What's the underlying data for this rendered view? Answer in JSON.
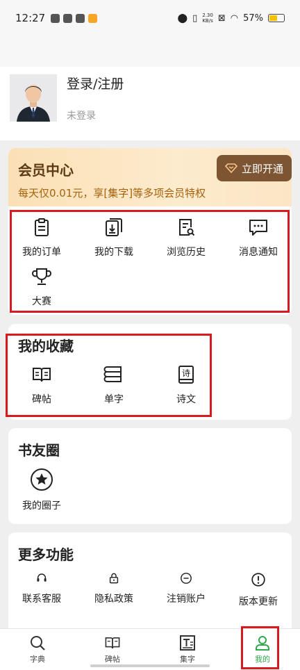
{
  "status_bar": {
    "time": "12:27",
    "net_speed_value": "2.30",
    "net_speed_unit": "KB/s",
    "battery": "57%",
    "battery_level": 0.57
  },
  "profile": {
    "title": "登录/注册",
    "subtitle": "未登录"
  },
  "member": {
    "title": "会员中心",
    "desc": "每天仅0.01元，享[集字]等多项会员特权",
    "button": "立即开通"
  },
  "quick_links": [
    {
      "label": "我的订单",
      "icon": "clipboard-icon"
    },
    {
      "label": "我的下载",
      "icon": "download-icon"
    },
    {
      "label": "浏览历史",
      "icon": "history-search-icon"
    },
    {
      "label": "消息通知",
      "icon": "message-icon"
    },
    {
      "label": "大赛",
      "icon": "trophy-icon"
    }
  ],
  "favorites": {
    "title": "我的收藏",
    "items": [
      {
        "label": "碑帖",
        "icon": "book-open-icon"
      },
      {
        "label": "单字",
        "icon": "stack-icon"
      },
      {
        "label": "诗文",
        "icon": "poem-book-icon",
        "glyph": "诗"
      }
    ]
  },
  "circle": {
    "title": "书友圈",
    "items": [
      {
        "label": "我的圈子",
        "icon": "star-circle-icon"
      }
    ]
  },
  "more": {
    "title": "更多功能",
    "items": [
      {
        "label": "联系客服",
        "icon": "headset-icon"
      },
      {
        "label": "隐私政策",
        "icon": "lock-icon"
      },
      {
        "label": "注销账户",
        "icon": "minus-circle-icon"
      },
      {
        "label": "版本更新",
        "icon": "info-circle-icon"
      }
    ]
  },
  "bottom_nav": [
    {
      "label": "字典",
      "icon": "search-icon"
    },
    {
      "label": "碑帖",
      "icon": "book-open-icon"
    },
    {
      "label": "集字",
      "icon": "text-box-icon",
      "glyph": "T"
    },
    {
      "label": "我的",
      "icon": "user-icon",
      "active": true
    }
  ],
  "colors": {
    "accent": "#2ea84a",
    "highlight_border": "#d71920",
    "member_button": "#7e5532"
  }
}
